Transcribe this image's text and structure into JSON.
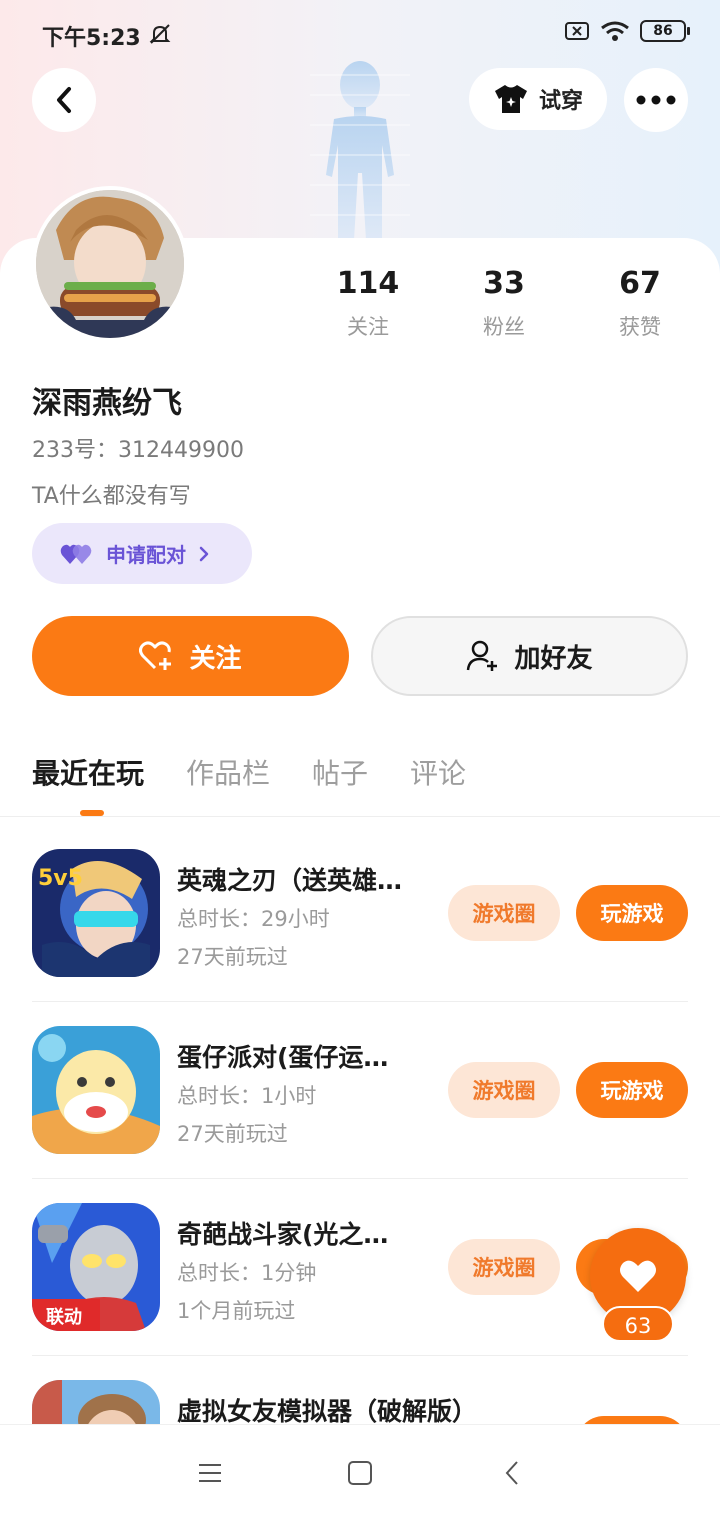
{
  "status_bar": {
    "time": "下午5:23",
    "battery": "86"
  },
  "header": {
    "tryon_label": "试穿"
  },
  "profile": {
    "stats": [
      {
        "value": "114",
        "label": "关注"
      },
      {
        "value": "33",
        "label": "粉丝"
      },
      {
        "value": "67",
        "label": "获赞"
      }
    ],
    "username": "深雨燕纷飞",
    "user_id": "233号：312449900",
    "bio": "TA什么都没有写",
    "match_label": "申请配对"
  },
  "actions": {
    "follow_label": "关注",
    "add_friend_label": "加好友"
  },
  "tabs": [
    {
      "label": "最近在玩",
      "active": true
    },
    {
      "label": "作品栏",
      "active": false
    },
    {
      "label": "帖子",
      "active": false
    },
    {
      "label": "评论",
      "active": false
    }
  ],
  "games": [
    {
      "name": "英魂之刃（送英雄…",
      "duration": "总时长：29小时",
      "last_played": "27天前玩过",
      "circle_label": "游戏圈",
      "play_label": "玩游戏",
      "icon_badge": "5v5"
    },
    {
      "name": "蛋仔派对(蛋仔运…",
      "duration": "总时长：1小时",
      "last_played": "27天前玩过",
      "circle_label": "游戏圈",
      "play_label": "玩游戏",
      "icon_badge": ""
    },
    {
      "name": "奇葩战斗家(光之…",
      "duration": "总时长：1分钟",
      "last_played": "1个月前玩过",
      "circle_label": "游戏圈",
      "play_label": "",
      "icon_badge": "联动"
    },
    {
      "name": "虚拟女友模拟器（破解版）",
      "duration": "",
      "last_played": "",
      "circle_label": "",
      "play_label": "",
      "icon_badge": ""
    }
  ],
  "floating_like": {
    "count": "63"
  },
  "colors": {
    "accent": "#fb7a14",
    "match_purple": "#6a54d6"
  }
}
